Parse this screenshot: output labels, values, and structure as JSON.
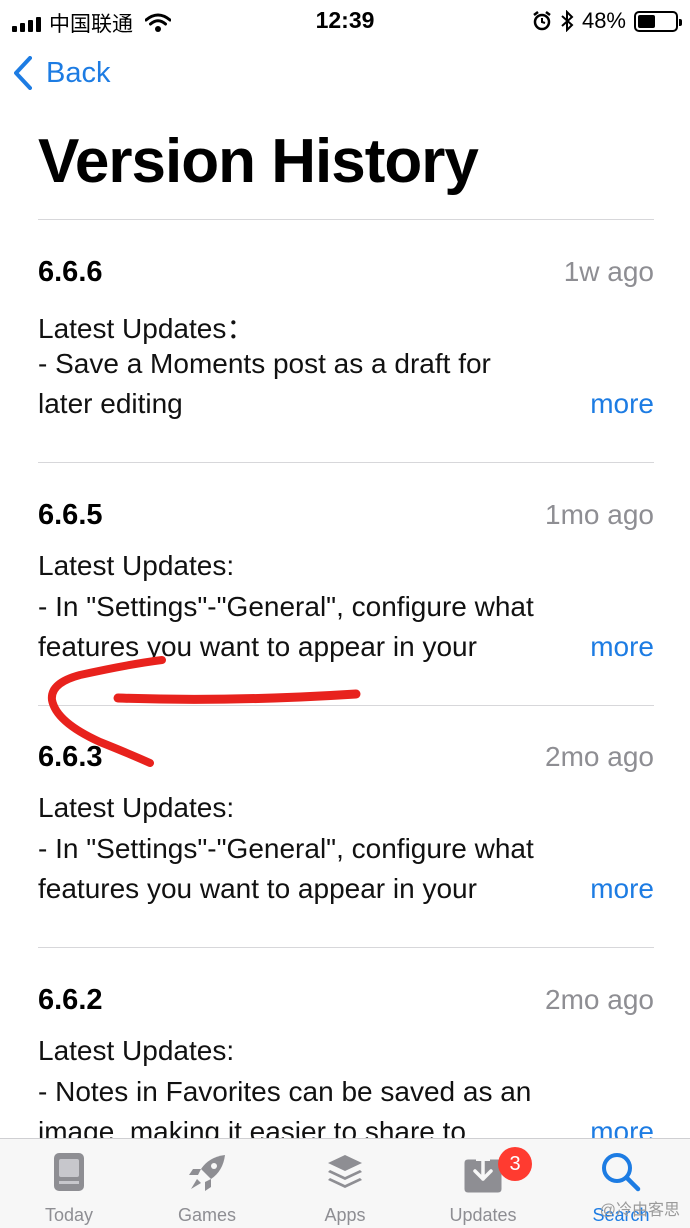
{
  "status_bar": {
    "carrier": "中国联通",
    "time": "12:39",
    "battery_percent": "48%",
    "battery_level": 0.48
  },
  "nav": {
    "back_label": "Back"
  },
  "page_title": "Version History",
  "entries": [
    {
      "version": "6.6.6",
      "time_ago": "1w ago",
      "lines": [
        "Latest Updates：",
        "- Save a Moments post as a draft for",
        "later editing"
      ],
      "more_label": "more"
    },
    {
      "version": "6.6.5",
      "time_ago": "1mo ago",
      "lines": [
        "Latest Updates:",
        "- In \"Settings\"-\"General\", configure what",
        "features you want to appear in your"
      ],
      "more_label": "more"
    },
    {
      "version": "6.6.3",
      "time_ago": "2mo ago",
      "lines": [
        "Latest Updates:",
        "- In \"Settings\"-\"General\", configure what",
        "features you want to appear in your"
      ],
      "more_label": "more"
    },
    {
      "version": "6.6.2",
      "time_ago": "2mo ago",
      "lines": [
        "Latest Updates:",
        "- Notes in Favorites can be saved as an",
        "image, making it easier to share to"
      ],
      "more_label": "more"
    }
  ],
  "tab_bar": {
    "tabs": [
      {
        "label": "Today",
        "icon": "today-icon"
      },
      {
        "label": "Games",
        "icon": "rocket-icon"
      },
      {
        "label": "Apps",
        "icon": "layers-icon"
      },
      {
        "label": "Updates",
        "icon": "download-icon"
      },
      {
        "label": "Search",
        "icon": "search-icon",
        "active": true
      }
    ],
    "updates_badge": "3"
  },
  "watermark": "@冷由客思",
  "colors": {
    "accent": "#1d7ce3",
    "secondary_text": "#8e8e93",
    "badge": "#ff3b30",
    "annotation": "#e8221d"
  }
}
